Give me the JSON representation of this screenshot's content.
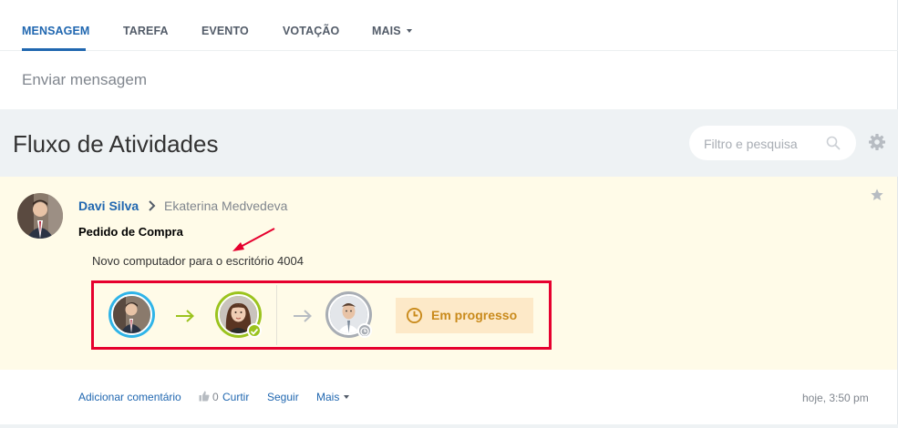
{
  "tabs": [
    {
      "label": "MENSAGEM",
      "active": true
    },
    {
      "label": "TAREFA"
    },
    {
      "label": "EVENTO"
    },
    {
      "label": "VOTAÇÃO"
    },
    {
      "label": "MAIS"
    }
  ],
  "composer": {
    "placeholder": "Enviar mensagem"
  },
  "feed": {
    "title": "Fluxo de Atividades",
    "search_placeholder": "Filtro e pesquisa"
  },
  "post": {
    "author": "Davi Silva",
    "recipient": "Ekaterina Medvedeva",
    "title": "Pedido de Compra",
    "description": "Novo computador para o escritório 4004",
    "status": "Em progresso"
  },
  "footer": {
    "comment": "Adicionar comentário",
    "like_count": "0",
    "like": "Curtir",
    "follow": "Seguir",
    "more": "Mais",
    "time": "hoje, 3:50 pm"
  },
  "colors": {
    "accent": "#2067b0",
    "highlight": "#e6002e",
    "approved": "#9bc31e",
    "pending": "#a8adb4",
    "status": "#c98a1b"
  }
}
